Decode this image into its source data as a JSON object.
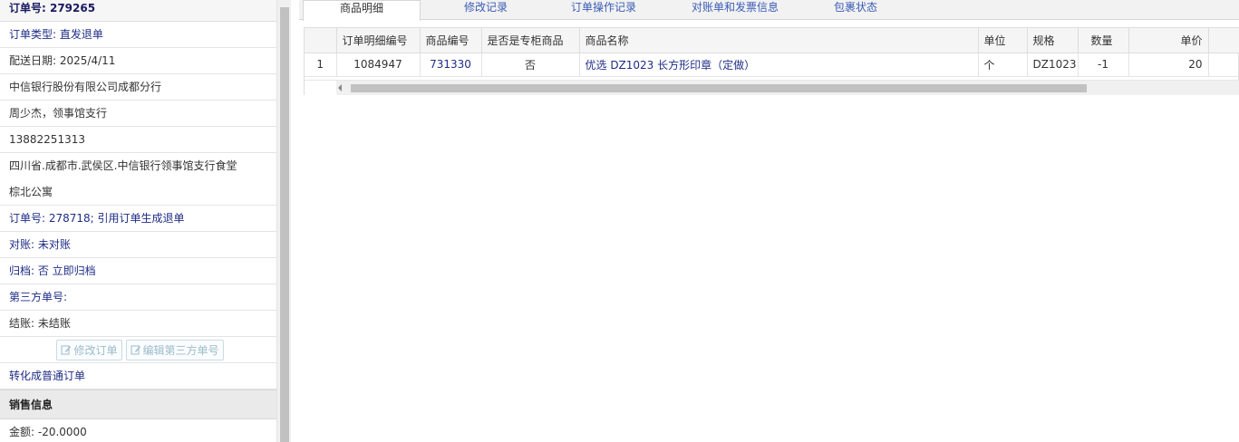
{
  "order": {
    "header": "订单号: 279265",
    "type": "订单类型: 直发退单",
    "delivery_date": "配送日期: 2025/4/11",
    "company": "中信银行股份有限公司成都分行",
    "contact": "周少杰，领事馆支行",
    "phone": "13882251313",
    "address_line1": "四川省.成都市.武侯区.中信银行领事馆支行食堂",
    "address_line2": "棕北公寓",
    "ref": "订单号: 278718; 引用订单生成退单",
    "reconcile": "对账: 未对账",
    "archive": "归档:  否 立即归档",
    "third_party": "第三方单号:",
    "settle": "结账: 未结账",
    "btn_edit": "修改订单",
    "btn_edit_third": "编辑第三方单号",
    "convert": "转化成普通订单",
    "sales_section": "销售信息",
    "amount": "金额: -20.0000"
  },
  "tabs": [
    {
      "label": "商品明细"
    },
    {
      "label": "修改记录"
    },
    {
      "label": "订单操作记录"
    },
    {
      "label": "对账单和发票信息"
    },
    {
      "label": "包裹状态"
    }
  ],
  "grid": {
    "columns": [
      "订单明细编号",
      "商品编号",
      "是否是专柜商品",
      "商品名称",
      "单位",
      "规格",
      "数量",
      "单价"
    ],
    "rows": [
      {
        "idx": "1",
        "detail_id": "1084947",
        "product_id": "731330",
        "counter": "否",
        "name": "优选 DZ1023 长方形印章（定做）",
        "unit": "个",
        "spec": "DZ1023",
        "qty": "-1",
        "price": "20"
      }
    ]
  }
}
